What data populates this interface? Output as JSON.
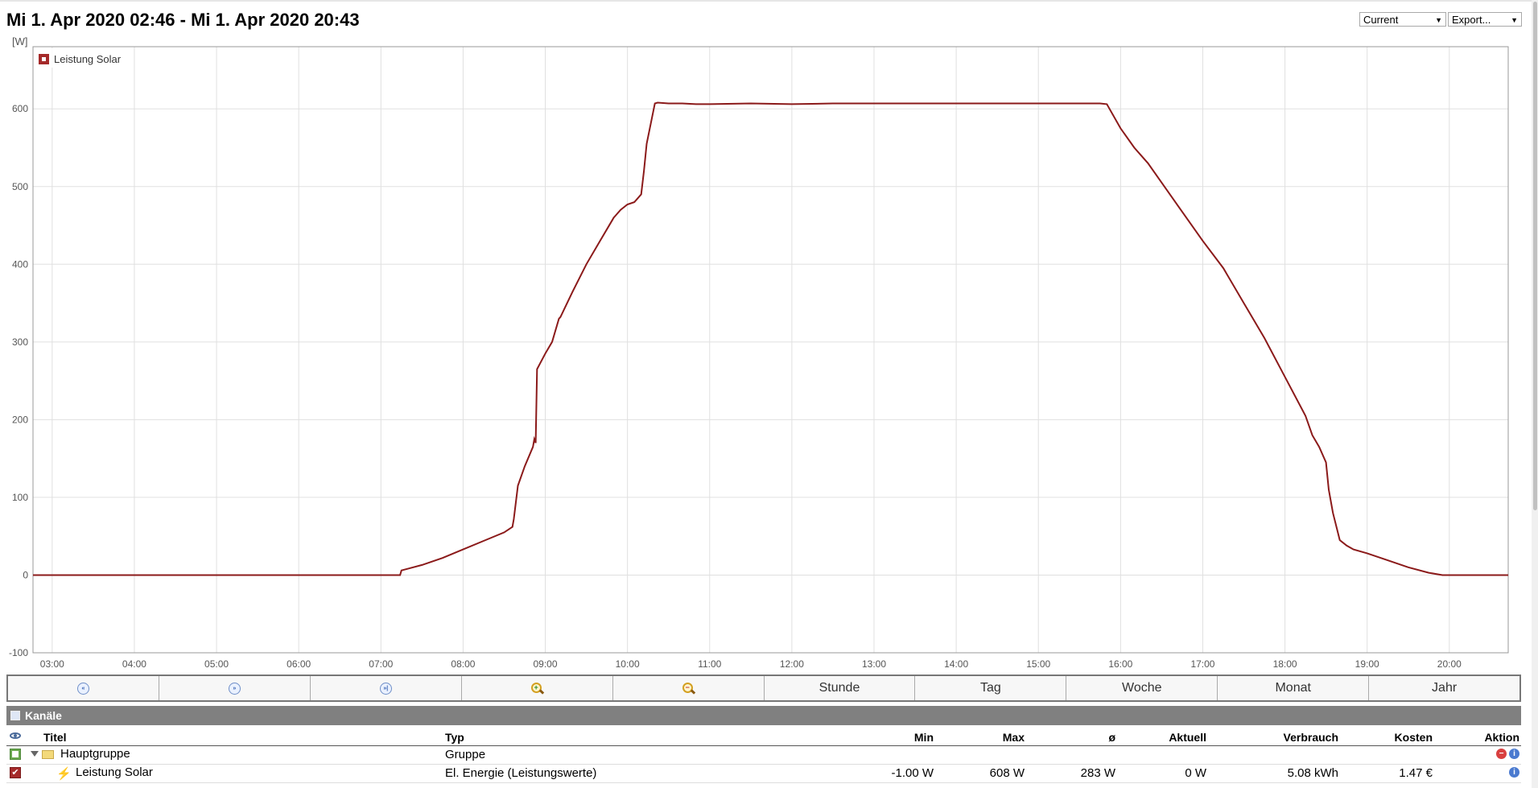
{
  "header": {
    "title": "Mi 1. Apr 2020 02:46 - Mi 1. Apr 2020 20:43",
    "current_select": "Current",
    "export_select": "Export..."
  },
  "chart_data": {
    "type": "line",
    "ylabel": "[W]",
    "ylim": [
      -100,
      680
    ],
    "yticks": [
      -100,
      0,
      100,
      200,
      300,
      400,
      500,
      600
    ],
    "xlim": [
      "02:46",
      "20:43"
    ],
    "xticks": [
      "03:00",
      "04:00",
      "05:00",
      "06:00",
      "07:00",
      "08:00",
      "09:00",
      "10:00",
      "11:00",
      "12:00",
      "13:00",
      "14:00",
      "15:00",
      "16:00",
      "17:00",
      "18:00",
      "19:00",
      "20:00"
    ],
    "grid": true,
    "legend_position": "top-left",
    "series": [
      {
        "name": "Leistung Solar",
        "color": "#8b1a1a",
        "x": [
          "02:46",
          "07:14",
          "07:15",
          "07:30",
          "07:45",
          "08:00",
          "08:15",
          "08:30",
          "08:36",
          "08:37",
          "08:40",
          "08:45",
          "08:51",
          "08:52",
          "08:53",
          "08:54",
          "09:00",
          "09:05",
          "09:10",
          "09:11",
          "09:20",
          "09:30",
          "09:40",
          "09:50",
          "09:55",
          "10:00",
          "10:05",
          "10:10",
          "10:12",
          "10:14",
          "10:20",
          "10:22",
          "10:30",
          "10:40",
          "10:50",
          "11:00",
          "11:30",
          "12:00",
          "12:30",
          "13:00",
          "13:30",
          "14:00",
          "14:30",
          "15:00",
          "15:30",
          "15:45",
          "15:50",
          "16:00",
          "16:10",
          "16:20",
          "16:30",
          "16:40",
          "17:00",
          "17:15",
          "17:30",
          "17:45",
          "18:00",
          "18:15",
          "18:20",
          "18:25",
          "18:30",
          "18:32",
          "18:35",
          "18:40",
          "18:45",
          "18:50",
          "19:00",
          "19:15",
          "19:30",
          "19:45",
          "19:55",
          "20:00",
          "20:43"
        ],
        "y": [
          0,
          0,
          6,
          13,
          22,
          33,
          44,
          55,
          62,
          72,
          115,
          140,
          165,
          175,
          170,
          265,
          285,
          300,
          330,
          332,
          365,
          400,
          430,
          460,
          470,
          477,
          480,
          490,
          520,
          555,
          607,
          608,
          607,
          607,
          606,
          606,
          607,
          606,
          607,
          607,
          607,
          607,
          607,
          607,
          607,
          607,
          606,
          575,
          550,
          530,
          505,
          480,
          430,
          395,
          350,
          305,
          255,
          205,
          180,
          165,
          145,
          110,
          80,
          45,
          38,
          33,
          28,
          19,
          10,
          3,
          0,
          0,
          0
        ]
      }
    ]
  },
  "nav": {
    "buttons": [
      {
        "name": "nav-back-button",
        "icon": "rewind-icon",
        "glyph": "«"
      },
      {
        "name": "nav-forward-button",
        "icon": "fast-forward-icon",
        "glyph": "»"
      },
      {
        "name": "nav-end-button",
        "icon": "skip-end-icon",
        "glyph": "»|"
      },
      {
        "name": "zoom-in-button",
        "icon": "zoom-in-icon",
        "glyph": "+"
      },
      {
        "name": "zoom-out-button",
        "icon": "zoom-out-icon",
        "glyph": "−"
      }
    ],
    "stunde": "Stunde",
    "tag": "Tag",
    "woche": "Woche",
    "monat": "Monat",
    "jahr": "Jahr"
  },
  "channels": {
    "title": "Kanäle",
    "columns": {
      "titel": "Titel",
      "typ": "Typ",
      "min": "Min",
      "max": "Max",
      "avg": "ø",
      "aktuell": "Aktuell",
      "verbrauch": "Verbrauch",
      "kosten": "Kosten",
      "aktion": "Aktion"
    },
    "rows": [
      {
        "titel": "Hauptgruppe",
        "typ": "Gruppe",
        "min": "",
        "max": "",
        "avg": "",
        "aktuell": "",
        "verbrauch": "",
        "kosten": "",
        "color": "#6aa84f"
      },
      {
        "titel": "Leistung Solar",
        "typ": "El. Energie (Leistungswerte)",
        "min": "-1.00 W",
        "max": "608 W",
        "avg": "283 W",
        "aktuell": "0 W",
        "verbrauch": "5.08 kWh",
        "kosten": "1.47 €",
        "color": "#a52a2a"
      }
    ]
  }
}
